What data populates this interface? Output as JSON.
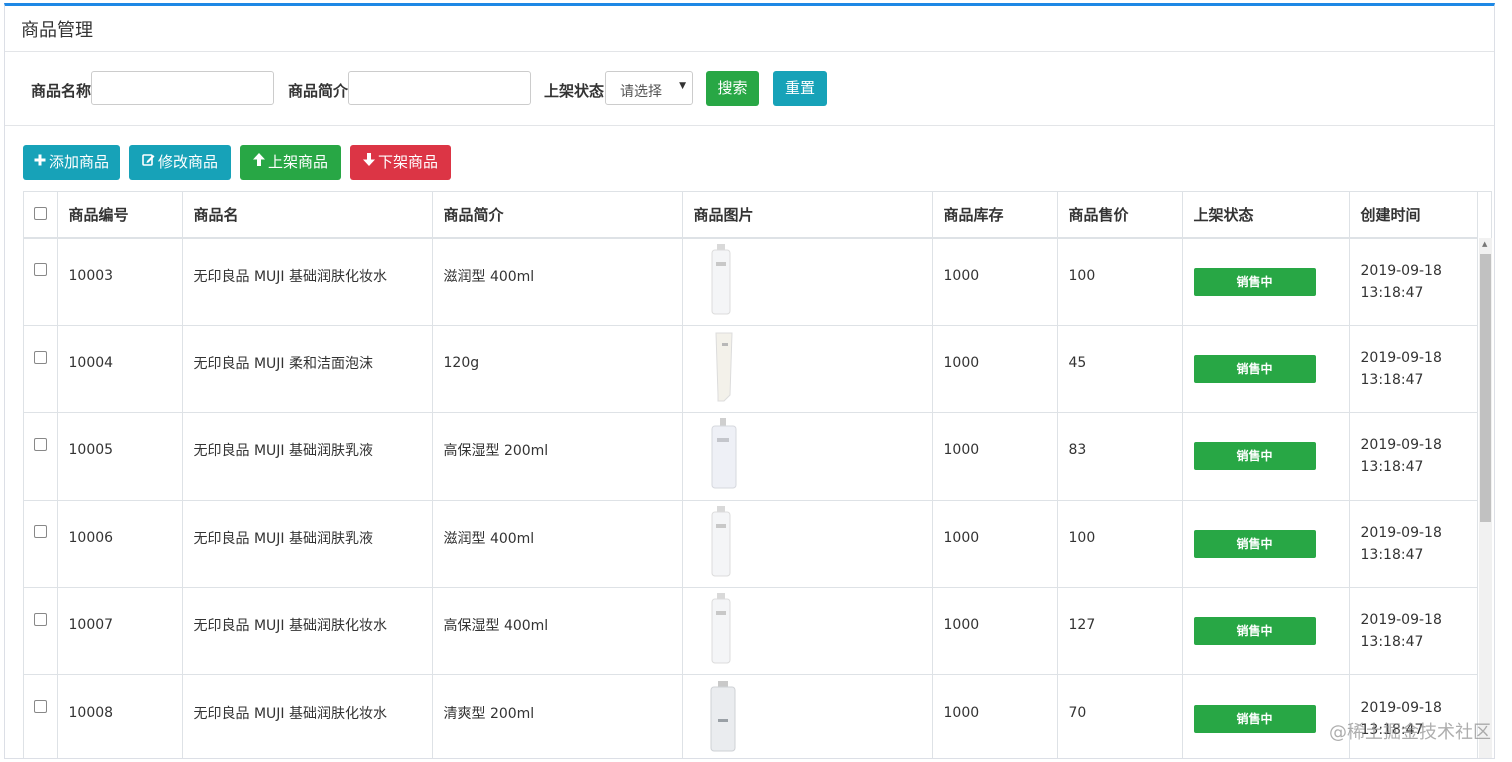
{
  "page": {
    "title": "商品管理"
  },
  "search": {
    "name_label": "商品名称",
    "name_value": "",
    "desc_label": "商品简介",
    "desc_value": "",
    "status_label": "上架状态",
    "status_selected": "请选择",
    "search_button": "搜索",
    "reset_button": "重置"
  },
  "toolbar": {
    "add": "添加商品",
    "edit": "修改商品",
    "on_shelf": "上架商品",
    "off_shelf": "下架商品"
  },
  "table": {
    "headers": [
      "商品编号",
      "商品名",
      "商品简介",
      "商品图片",
      "商品库存",
      "商品售价",
      "上架状态",
      "创建时间"
    ],
    "rows": [
      {
        "id": "10003",
        "name": "无印良品 MUJI 基础润肤化妆水",
        "desc": "滋润型 400ml",
        "image": "tall-bottle",
        "stock": "1000",
        "price": "100",
        "status": "销售中",
        "date": "2019-09-18",
        "time": "13:18:47"
      },
      {
        "id": "10004",
        "name": "无印良品 MUJI 柔和洁面泡沫",
        "desc": "120g",
        "image": "tube",
        "stock": "1000",
        "price": "45",
        "status": "销售中",
        "date": "2019-09-18",
        "time": "13:18:47"
      },
      {
        "id": "10005",
        "name": "无印良品 MUJI 基础润肤乳液",
        "desc": "高保湿型 200ml",
        "image": "pump-bottle",
        "stock": "1000",
        "price": "83",
        "status": "销售中",
        "date": "2019-09-18",
        "time": "13:18:47"
      },
      {
        "id": "10006",
        "name": "无印良品 MUJI 基础润肤乳液",
        "desc": "滋润型 400ml",
        "image": "tall-bottle",
        "stock": "1000",
        "price": "100",
        "status": "销售中",
        "date": "2019-09-18",
        "time": "13:18:47"
      },
      {
        "id": "10007",
        "name": "无印良品 MUJI 基础润肤化妆水",
        "desc": "高保湿型 400ml",
        "image": "tall-bottle",
        "stock": "1000",
        "price": "127",
        "status": "销售中",
        "date": "2019-09-18",
        "time": "13:18:47"
      },
      {
        "id": "10008",
        "name": "无印良品 MUJI 基础润肤化妆水",
        "desc": "清爽型 200ml",
        "image": "clear-bottle",
        "stock": "1000",
        "price": "70",
        "status": "销售中",
        "date": "2019-09-18",
        "time": "13:18:47"
      }
    ]
  },
  "colors": {
    "accent": "#1e88e5",
    "green": "#28a745",
    "teal": "#17a2b8",
    "red": "#dc3545"
  },
  "watermark": "@稀土掘金技术社区"
}
